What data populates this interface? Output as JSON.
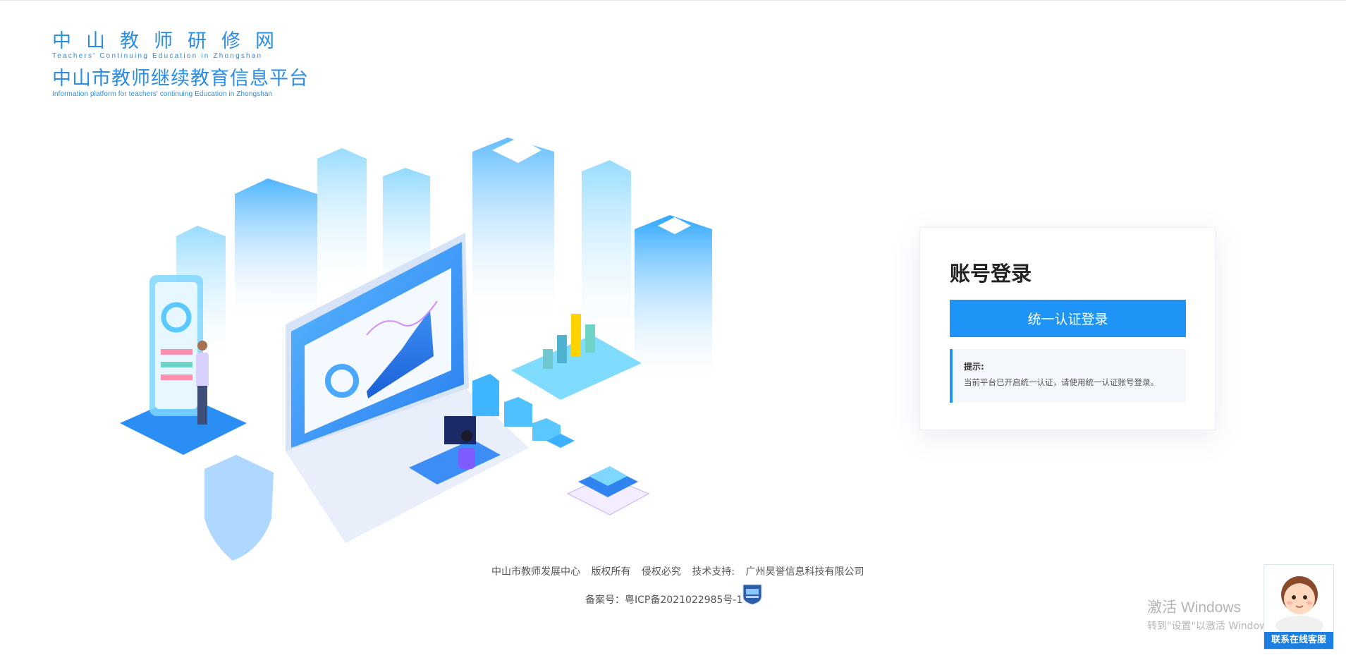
{
  "logo": {
    "line1": "中山教师研修网",
    "line1_sub": "Teachers' Continuing Education in Zhongshan",
    "line2": "中山市教师继续教育信息平台",
    "line2_sub": "Information platform for teachers' continuing Education in Zhongshan"
  },
  "login": {
    "title": "账号登录",
    "sso_button": "统一认证登录",
    "tip_title": "提示:",
    "tip_text": "当前平台已开启统一认证，请使用统一认证账号登录。"
  },
  "footer": {
    "org": "中山市教师发展中心",
    "copyright": "版权所有",
    "infringe": "侵权必究",
    "support_label": "技术支持:",
    "support_company": "广州昊誉信息科技有限公司",
    "icp": "备案号：粤ICP备2021022985号-1"
  },
  "watermark": {
    "line1": "激活 Windows",
    "line2": "转到\"设置\"以激活 Windows。"
  },
  "customer_service": {
    "label": "联系在线客服"
  },
  "colors": {
    "accent": "#1e94f7",
    "logo": "#2b8ee6"
  }
}
